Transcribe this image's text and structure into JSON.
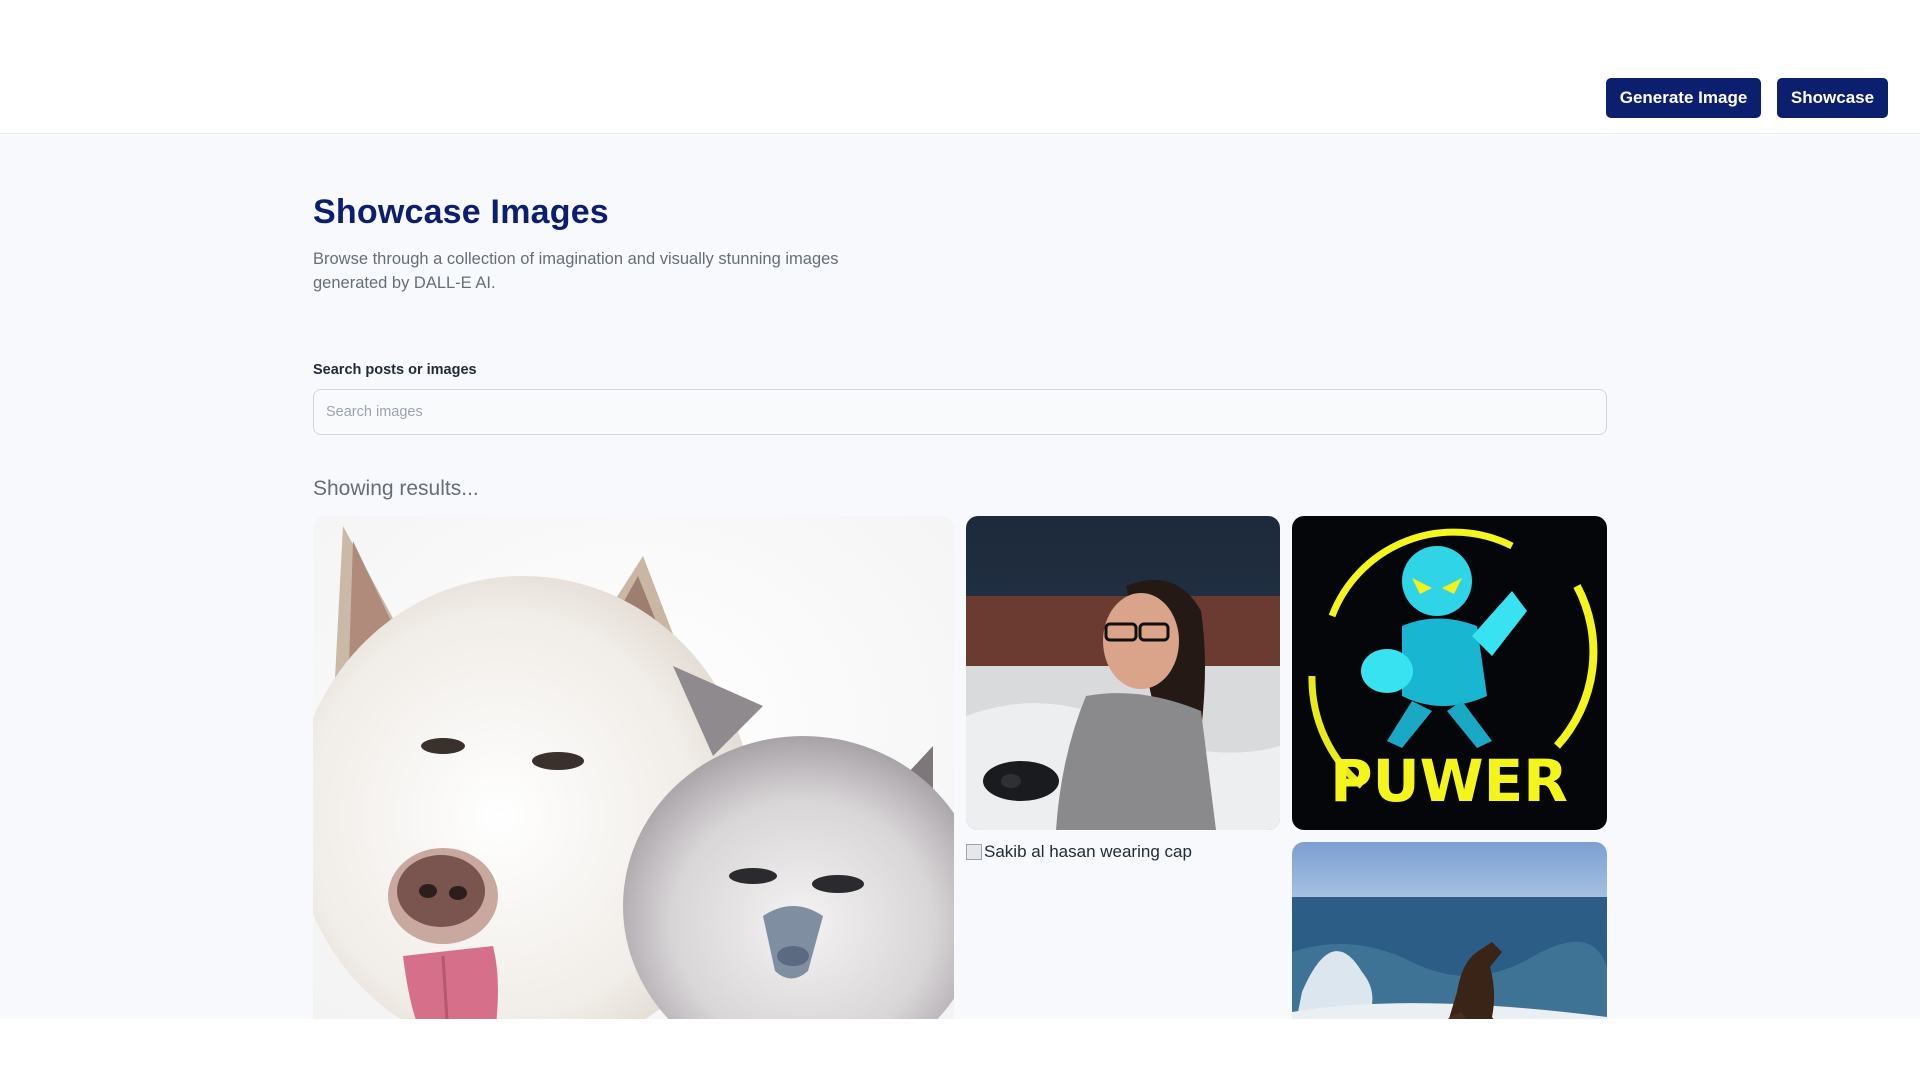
{
  "header": {
    "generate_label": "Generate Image",
    "showcase_label": "Showcase"
  },
  "page": {
    "title": "Showcase Images",
    "description": "Browse through a collection of imagination and visually stunning images generated by DALL-E AI."
  },
  "search": {
    "label": "Search posts or images",
    "placeholder": "Search images",
    "value": ""
  },
  "results": {
    "heading": "Showing results...",
    "cards": [
      {
        "alt": "dog and cat"
      },
      {
        "alt": "woman playing video games"
      },
      {
        "alt": "power neon logo",
        "logo_text": "PUWER"
      },
      {
        "alt": "Sakib al hasan wearing cap"
      },
      {
        "alt": "horse on beach"
      }
    ]
  },
  "colors": {
    "brand": "#0b1f6e",
    "muted_text": "#666e75",
    "background": "#f8f9fc"
  }
}
